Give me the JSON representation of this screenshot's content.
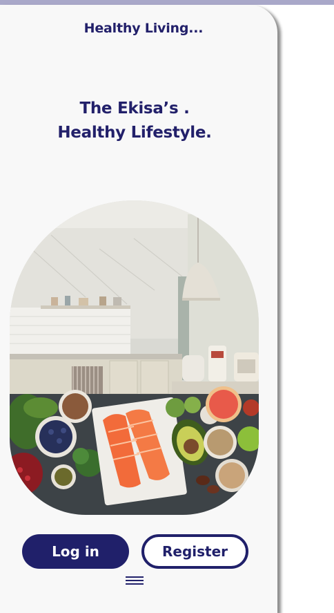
{
  "header": {
    "title": "Healthy Living..."
  },
  "hero": {
    "line1": "The Ekisa’s .",
    "line2": "Healthy Lifestyle."
  },
  "actions": {
    "login_label": "Log in",
    "register_label": "Register"
  },
  "icons": {
    "menu": "hamburger-menu-icon"
  },
  "colors": {
    "brand": "#20206a",
    "background": "#f8f8f8",
    "top_bar": "#a9a8c9"
  }
}
